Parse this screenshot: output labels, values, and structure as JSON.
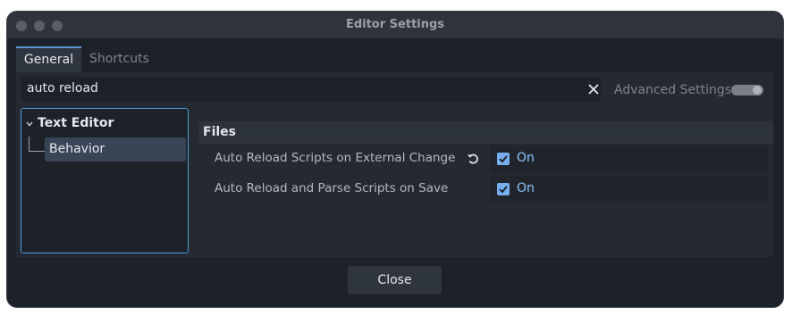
{
  "window": {
    "title": "Editor Settings"
  },
  "tabs": [
    {
      "label": "General",
      "active": true
    },
    {
      "label": "Shortcuts",
      "active": false
    }
  ],
  "search": {
    "value": "auto reload"
  },
  "advanced": {
    "label": "Advanced Settings",
    "enabled": false
  },
  "tree": {
    "parent": "Text Editor",
    "child": "Behavior"
  },
  "section": {
    "title": "Files"
  },
  "properties": [
    {
      "label": "Auto Reload Scripts on External Change",
      "value": "On",
      "checked": true,
      "revertable": true
    },
    {
      "label": "Auto Reload and Parse Scripts on Save",
      "value": "On",
      "checked": true,
      "revertable": false
    }
  ],
  "footer": {
    "close_label": "Close"
  },
  "colors": {
    "accent": "#5e93cf",
    "checkbox": "#76aef0",
    "value_text": "#8ec2ff",
    "background": "#1d2229"
  },
  "icons": [
    "close-icon",
    "chevron-down-icon",
    "revert-icon",
    "checkmark-icon"
  ]
}
